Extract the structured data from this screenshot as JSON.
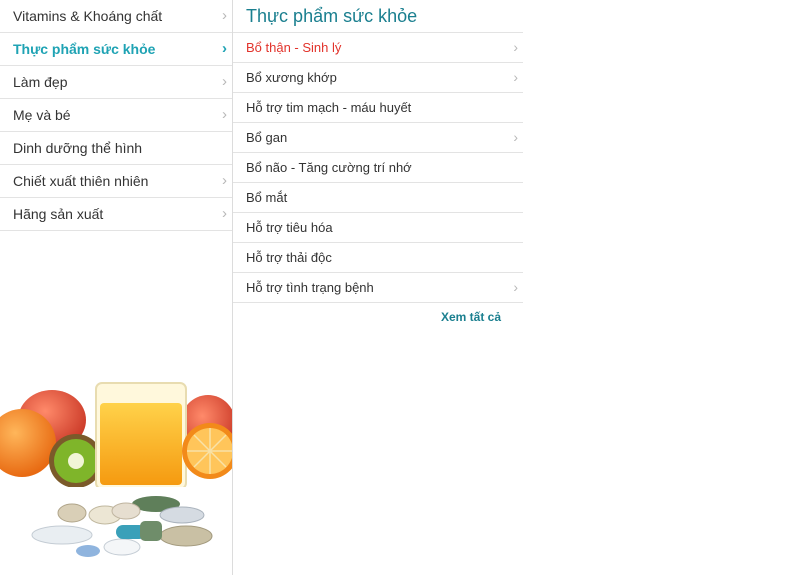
{
  "sidebar": {
    "items": [
      {
        "label": "Vitamins & Khoáng chất",
        "chevron": "›"
      },
      {
        "label": "Thực phẩm sức khỏe",
        "chevron": "›"
      },
      {
        "label": "Làm đẹp",
        "chevron": "›"
      },
      {
        "label": "Mẹ và bé",
        "chevron": "›"
      },
      {
        "label": "Dinh dưỡng thể hình",
        "chevron": ""
      },
      {
        "label": "Chiết xuất thiên nhiên",
        "chevron": "›"
      },
      {
        "label": "Hãng sản xuất",
        "chevron": "›"
      }
    ]
  },
  "submenu": {
    "title": "Thực phẩm sức khỏe",
    "items": [
      {
        "label": "Bổ thận - Sinh lý",
        "chevron": "›"
      },
      {
        "label": "Bổ xương khớp",
        "chevron": "›"
      },
      {
        "label": "Hỗ trợ tim mạch - máu huyết",
        "chevron": ""
      },
      {
        "label": "Bổ gan",
        "chevron": "›"
      },
      {
        "label": "Bổ não - Tăng cường trí nhớ",
        "chevron": ""
      },
      {
        "label": "Bổ mắt",
        "chevron": ""
      },
      {
        "label": "Hỗ trợ tiêu hóa",
        "chevron": ""
      },
      {
        "label": "Hỗ trợ thải độc",
        "chevron": ""
      },
      {
        "label": "Hỗ trợ tình trạng bệnh",
        "chevron": "›"
      }
    ],
    "view_all": "Xem tất cả"
  },
  "colors": {
    "active": "#1fa3b4",
    "title": "#1a7f8f",
    "highlight": "#e2332b",
    "text": "#333333",
    "divider": "#e3e3e3"
  }
}
